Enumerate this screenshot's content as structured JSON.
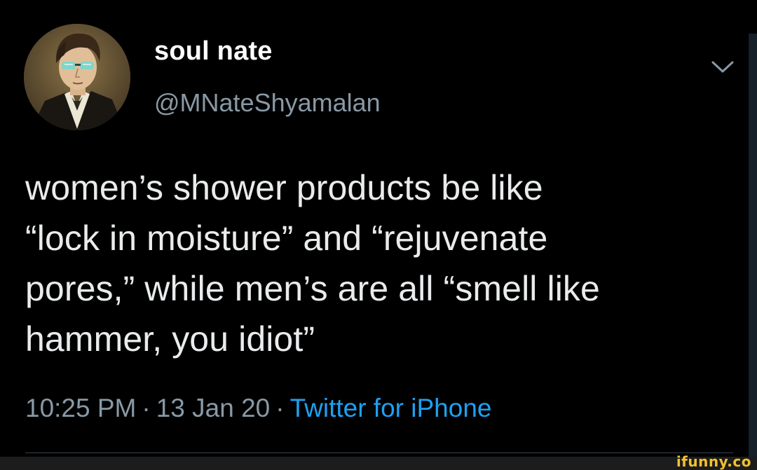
{
  "tweet": {
    "display_name": "soul nate",
    "handle": "@MNateShyamalan",
    "text_lines": [
      "women’s shower products be like",
      "“lock in moisture” and “rejuvenate",
      "pores,” while men’s are all “smell like",
      "hammer, you idiot”"
    ],
    "time": "10:25 PM",
    "date": "13 Jan 20",
    "source": "Twitter for iPhone",
    "separator": "·",
    "menu_icon": "chevron-down-icon"
  },
  "watermark": "ifunny.co",
  "colors": {
    "background": "#000000",
    "text": "#e9ebec",
    "secondary_text": "#8899a6",
    "link": "#1da1f2",
    "watermark": "#f2c12e"
  }
}
